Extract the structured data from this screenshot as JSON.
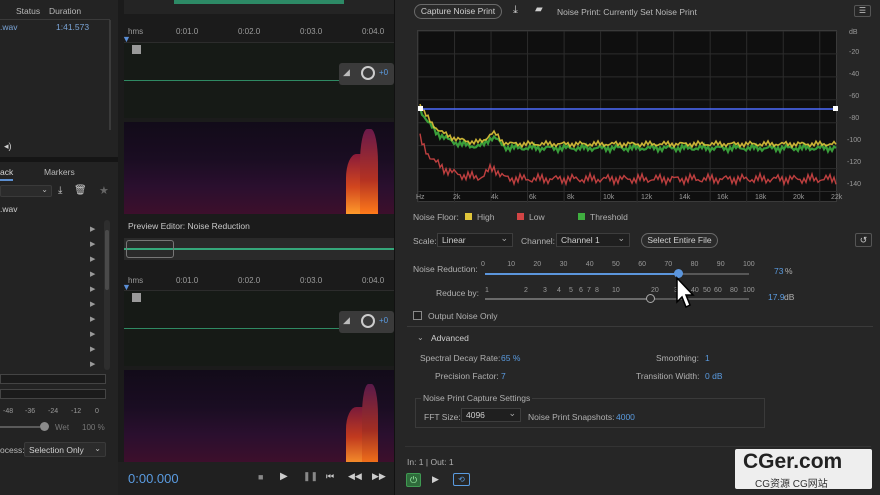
{
  "files_panel": {
    "col_status": "Status",
    "col_duration": "Duration",
    "file_name": ".wav",
    "file_duration": "1:41.573"
  },
  "left_tabs": {
    "tab1": "ack",
    "tab2": "Markers"
  },
  "left_file": ".wav",
  "meter": {
    "m48": "-48",
    "m36": "-36",
    "m24": "-24",
    "m12": "-12",
    "m0": "0"
  },
  "wet": {
    "label": "Wet",
    "value": "100 %"
  },
  "process": {
    "label": "ocess:",
    "value": "Selection Only"
  },
  "editor": {
    "ruler_top": {
      "hms": "hms",
      "t1": "0:01.0",
      "t2": "0:02.0",
      "t3": "0:03.0",
      "t4": "0:04.0"
    },
    "ruler_bottom": {
      "hms": "hms",
      "t1": "0:01.0",
      "t2": "0:02.0",
      "t3": "0:03.0",
      "t4": "0:04.0"
    },
    "preview_title": "Preview Editor: Noise Reduction",
    "gain_top": "+0",
    "gain_bottom": "+0",
    "time": "0:00.000"
  },
  "dialog": {
    "capture_btn": "Capture Noise Print",
    "noise_print_status": "Noise Print:  Currently Set Noise Print",
    "graph": {
      "db_labels": [
        "dB",
        "-20",
        "-40",
        "-60",
        "-80",
        "-100",
        "-120",
        "-140"
      ],
      "freq_labels": [
        "Hz",
        "2k",
        "4k",
        "6k",
        "8k",
        "10k",
        "12k",
        "14k",
        "16k",
        "18k",
        "20k",
        "22k"
      ]
    },
    "legend": {
      "title": "Noise Floor:",
      "high": "High",
      "low": "Low",
      "threshold": "Threshold",
      "colors": {
        "high": "#e0c53a",
        "low": "#d24545",
        "threshold": "#3fae3f"
      }
    },
    "scale": {
      "label": "Scale:",
      "value": "Linear"
    },
    "channel": {
      "label": "Channel:",
      "value": "Channel 1"
    },
    "select_entire_btn": "Select Entire File",
    "noise_reduction": {
      "label": "Noise Reduction:",
      "value": "73",
      "unit": "%",
      "percent": 73,
      "ticks": [
        "0",
        "10",
        "20",
        "30",
        "40",
        "50",
        "60",
        "70",
        "80",
        "90",
        "100"
      ]
    },
    "reduce_by": {
      "label": "Reduce by:",
      "value": "17.9",
      "unit": "dB",
      "ticks": [
        "1",
        "2",
        "3",
        "4",
        "5",
        "6",
        "7",
        "8",
        "10",
        "20",
        "30",
        "40",
        "50",
        "60",
        "80",
        "100"
      ]
    },
    "output_noise_only": "Output Noise Only",
    "advanced": {
      "title": "Advanced",
      "spectral_decay_label": "Spectral Decay Rate:",
      "spectral_decay_value": "65 %",
      "smoothing_label": "Smoothing:",
      "smoothing_value": "1",
      "precision_label": "Precision Factor:",
      "precision_value": "7",
      "transition_label": "Transition Width:",
      "transition_value": "0 dB"
    },
    "capture_settings": {
      "title": "Noise Print Capture Settings",
      "fft_label": "FFT Size:",
      "fft_value": "4096",
      "snapshots_label": "Noise Print Snapshots:",
      "snapshots_value": "4000"
    },
    "in_out": "In: 1 | Out: 1"
  },
  "watermark": {
    "title": "CGer.com",
    "subtitle": "CG资源 CG网站"
  },
  "colors": {
    "accent": "#5a9be0",
    "waveform": "#4ec9a0",
    "threshold_line": "#4d6cff"
  }
}
